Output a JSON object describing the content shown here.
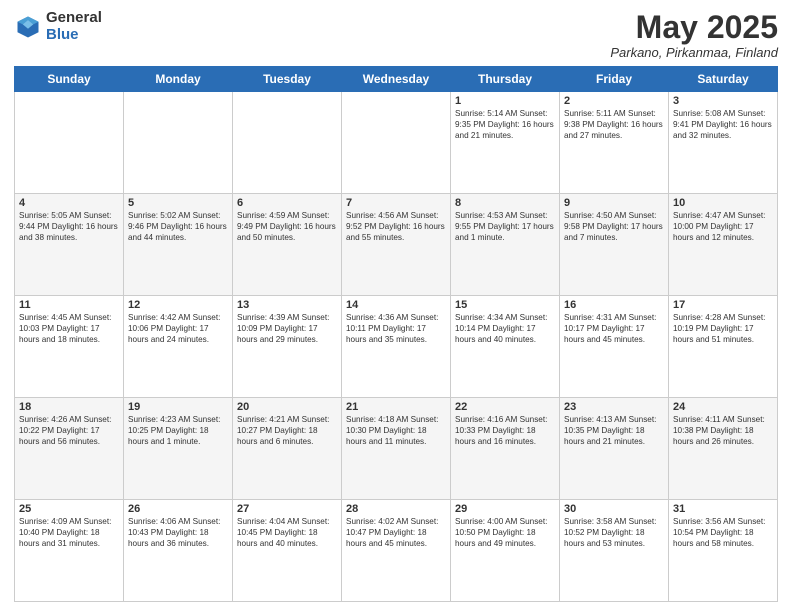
{
  "header": {
    "logo_general": "General",
    "logo_blue": "Blue",
    "title": "May 2025",
    "location": "Parkano, Pirkanmaa, Finland"
  },
  "days_of_week": [
    "Sunday",
    "Monday",
    "Tuesday",
    "Wednesday",
    "Thursday",
    "Friday",
    "Saturday"
  ],
  "weeks": [
    [
      {
        "day": "",
        "info": ""
      },
      {
        "day": "",
        "info": ""
      },
      {
        "day": "",
        "info": ""
      },
      {
        "day": "",
        "info": ""
      },
      {
        "day": "1",
        "info": "Sunrise: 5:14 AM\nSunset: 9:35 PM\nDaylight: 16 hours\nand 21 minutes."
      },
      {
        "day": "2",
        "info": "Sunrise: 5:11 AM\nSunset: 9:38 PM\nDaylight: 16 hours\nand 27 minutes."
      },
      {
        "day": "3",
        "info": "Sunrise: 5:08 AM\nSunset: 9:41 PM\nDaylight: 16 hours\nand 32 minutes."
      }
    ],
    [
      {
        "day": "4",
        "info": "Sunrise: 5:05 AM\nSunset: 9:44 PM\nDaylight: 16 hours\nand 38 minutes."
      },
      {
        "day": "5",
        "info": "Sunrise: 5:02 AM\nSunset: 9:46 PM\nDaylight: 16 hours\nand 44 minutes."
      },
      {
        "day": "6",
        "info": "Sunrise: 4:59 AM\nSunset: 9:49 PM\nDaylight: 16 hours\nand 50 minutes."
      },
      {
        "day": "7",
        "info": "Sunrise: 4:56 AM\nSunset: 9:52 PM\nDaylight: 16 hours\nand 55 minutes."
      },
      {
        "day": "8",
        "info": "Sunrise: 4:53 AM\nSunset: 9:55 PM\nDaylight: 17 hours\nand 1 minute."
      },
      {
        "day": "9",
        "info": "Sunrise: 4:50 AM\nSunset: 9:58 PM\nDaylight: 17 hours\nand 7 minutes."
      },
      {
        "day": "10",
        "info": "Sunrise: 4:47 AM\nSunset: 10:00 PM\nDaylight: 17 hours\nand 12 minutes."
      }
    ],
    [
      {
        "day": "11",
        "info": "Sunrise: 4:45 AM\nSunset: 10:03 PM\nDaylight: 17 hours\nand 18 minutes."
      },
      {
        "day": "12",
        "info": "Sunrise: 4:42 AM\nSunset: 10:06 PM\nDaylight: 17 hours\nand 24 minutes."
      },
      {
        "day": "13",
        "info": "Sunrise: 4:39 AM\nSunset: 10:09 PM\nDaylight: 17 hours\nand 29 minutes."
      },
      {
        "day": "14",
        "info": "Sunrise: 4:36 AM\nSunset: 10:11 PM\nDaylight: 17 hours\nand 35 minutes."
      },
      {
        "day": "15",
        "info": "Sunrise: 4:34 AM\nSunset: 10:14 PM\nDaylight: 17 hours\nand 40 minutes."
      },
      {
        "day": "16",
        "info": "Sunrise: 4:31 AM\nSunset: 10:17 PM\nDaylight: 17 hours\nand 45 minutes."
      },
      {
        "day": "17",
        "info": "Sunrise: 4:28 AM\nSunset: 10:19 PM\nDaylight: 17 hours\nand 51 minutes."
      }
    ],
    [
      {
        "day": "18",
        "info": "Sunrise: 4:26 AM\nSunset: 10:22 PM\nDaylight: 17 hours\nand 56 minutes."
      },
      {
        "day": "19",
        "info": "Sunrise: 4:23 AM\nSunset: 10:25 PM\nDaylight: 18 hours\nand 1 minute."
      },
      {
        "day": "20",
        "info": "Sunrise: 4:21 AM\nSunset: 10:27 PM\nDaylight: 18 hours\nand 6 minutes."
      },
      {
        "day": "21",
        "info": "Sunrise: 4:18 AM\nSunset: 10:30 PM\nDaylight: 18 hours\nand 11 minutes."
      },
      {
        "day": "22",
        "info": "Sunrise: 4:16 AM\nSunset: 10:33 PM\nDaylight: 18 hours\nand 16 minutes."
      },
      {
        "day": "23",
        "info": "Sunrise: 4:13 AM\nSunset: 10:35 PM\nDaylight: 18 hours\nand 21 minutes."
      },
      {
        "day": "24",
        "info": "Sunrise: 4:11 AM\nSunset: 10:38 PM\nDaylight: 18 hours\nand 26 minutes."
      }
    ],
    [
      {
        "day": "25",
        "info": "Sunrise: 4:09 AM\nSunset: 10:40 PM\nDaylight: 18 hours\nand 31 minutes."
      },
      {
        "day": "26",
        "info": "Sunrise: 4:06 AM\nSunset: 10:43 PM\nDaylight: 18 hours\nand 36 minutes."
      },
      {
        "day": "27",
        "info": "Sunrise: 4:04 AM\nSunset: 10:45 PM\nDaylight: 18 hours\nand 40 minutes."
      },
      {
        "day": "28",
        "info": "Sunrise: 4:02 AM\nSunset: 10:47 PM\nDaylight: 18 hours\nand 45 minutes."
      },
      {
        "day": "29",
        "info": "Sunrise: 4:00 AM\nSunset: 10:50 PM\nDaylight: 18 hours\nand 49 minutes."
      },
      {
        "day": "30",
        "info": "Sunrise: 3:58 AM\nSunset: 10:52 PM\nDaylight: 18 hours\nand 53 minutes."
      },
      {
        "day": "31",
        "info": "Sunrise: 3:56 AM\nSunset: 10:54 PM\nDaylight: 18 hours\nand 58 minutes."
      }
    ]
  ]
}
